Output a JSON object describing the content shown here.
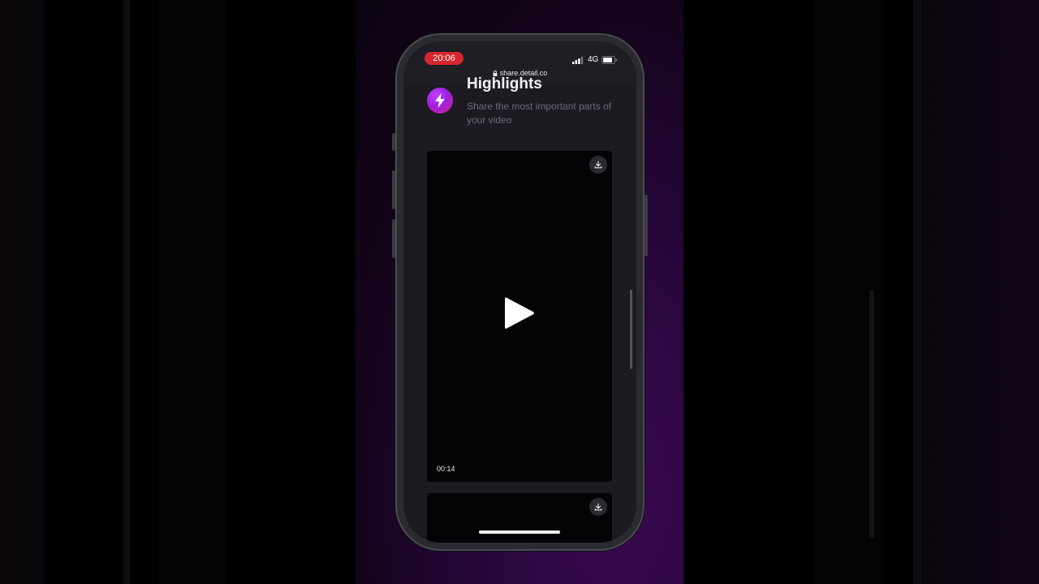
{
  "status_bar": {
    "time": "20:06",
    "network": "4G",
    "url": "share.detail.co"
  },
  "section": {
    "title": "Highlights",
    "description": "Share the most important parts of your video",
    "icon": "lightning-icon"
  },
  "videos": [
    {
      "duration": "00:14"
    },
    {
      "duration": ""
    }
  ],
  "colors": {
    "time_pill": "#d7262e",
    "accent_gradient_start": "#c040ff",
    "accent_gradient_end": "#d0207a",
    "screen_bg": "#1b1b21"
  }
}
